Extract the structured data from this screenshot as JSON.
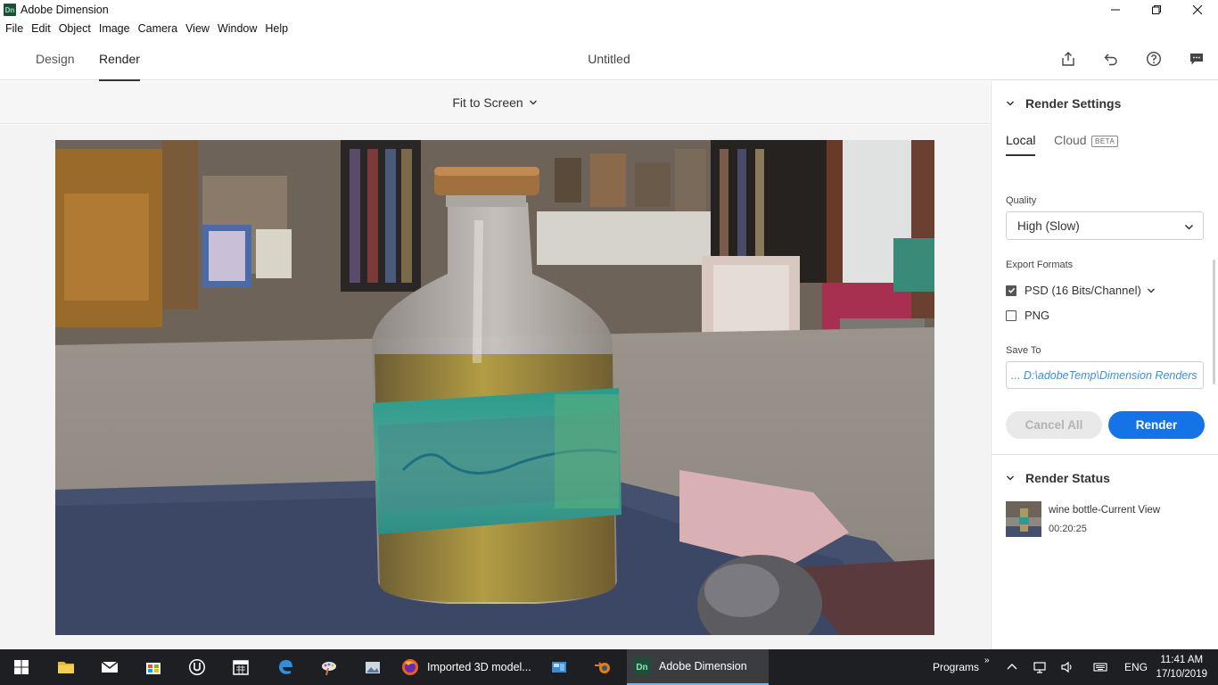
{
  "window": {
    "title": "Adobe Dimension",
    "app_badge": "Dn"
  },
  "menu": [
    "File",
    "Edit",
    "Object",
    "Image",
    "Camera",
    "View",
    "Window",
    "Help"
  ],
  "header": {
    "tabs": [
      {
        "label": "Design"
      },
      {
        "label": "Render"
      }
    ],
    "document_title": "Untitled"
  },
  "view": {
    "zoom_label": "Fit to Screen"
  },
  "panel": {
    "render_settings_title": "Render Settings",
    "tab_local": "Local",
    "tab_cloud": "Cloud",
    "beta_badge": "BETA",
    "quality_label": "Quality",
    "quality_value": "High (Slow)",
    "export_formats_label": "Export Formats",
    "formats": [
      {
        "label": "PSD (16 Bits/Channel)",
        "checked": true
      },
      {
        "label": "PNG",
        "checked": false
      }
    ],
    "save_to_label": "Save To",
    "save_to_value": "... D:\\adobeTemp\\Dimension Renders",
    "cancel_label": "Cancel All",
    "render_label": "Render",
    "render_status_title": "Render Status",
    "status_item_name": "wine bottle-Current View",
    "status_item_time": "00:20:25"
  },
  "taskbar": {
    "firefox_label": "Imported 3D model...",
    "dimension_label": "Adobe Dimension",
    "programs_label": "Programs",
    "language": "ENG",
    "time": "11:41 AM",
    "date": "17/10/2019"
  },
  "colors": {
    "accent": "#1473e6",
    "save_path": "#3d8fd9",
    "taskbar": "#1e1f22"
  }
}
